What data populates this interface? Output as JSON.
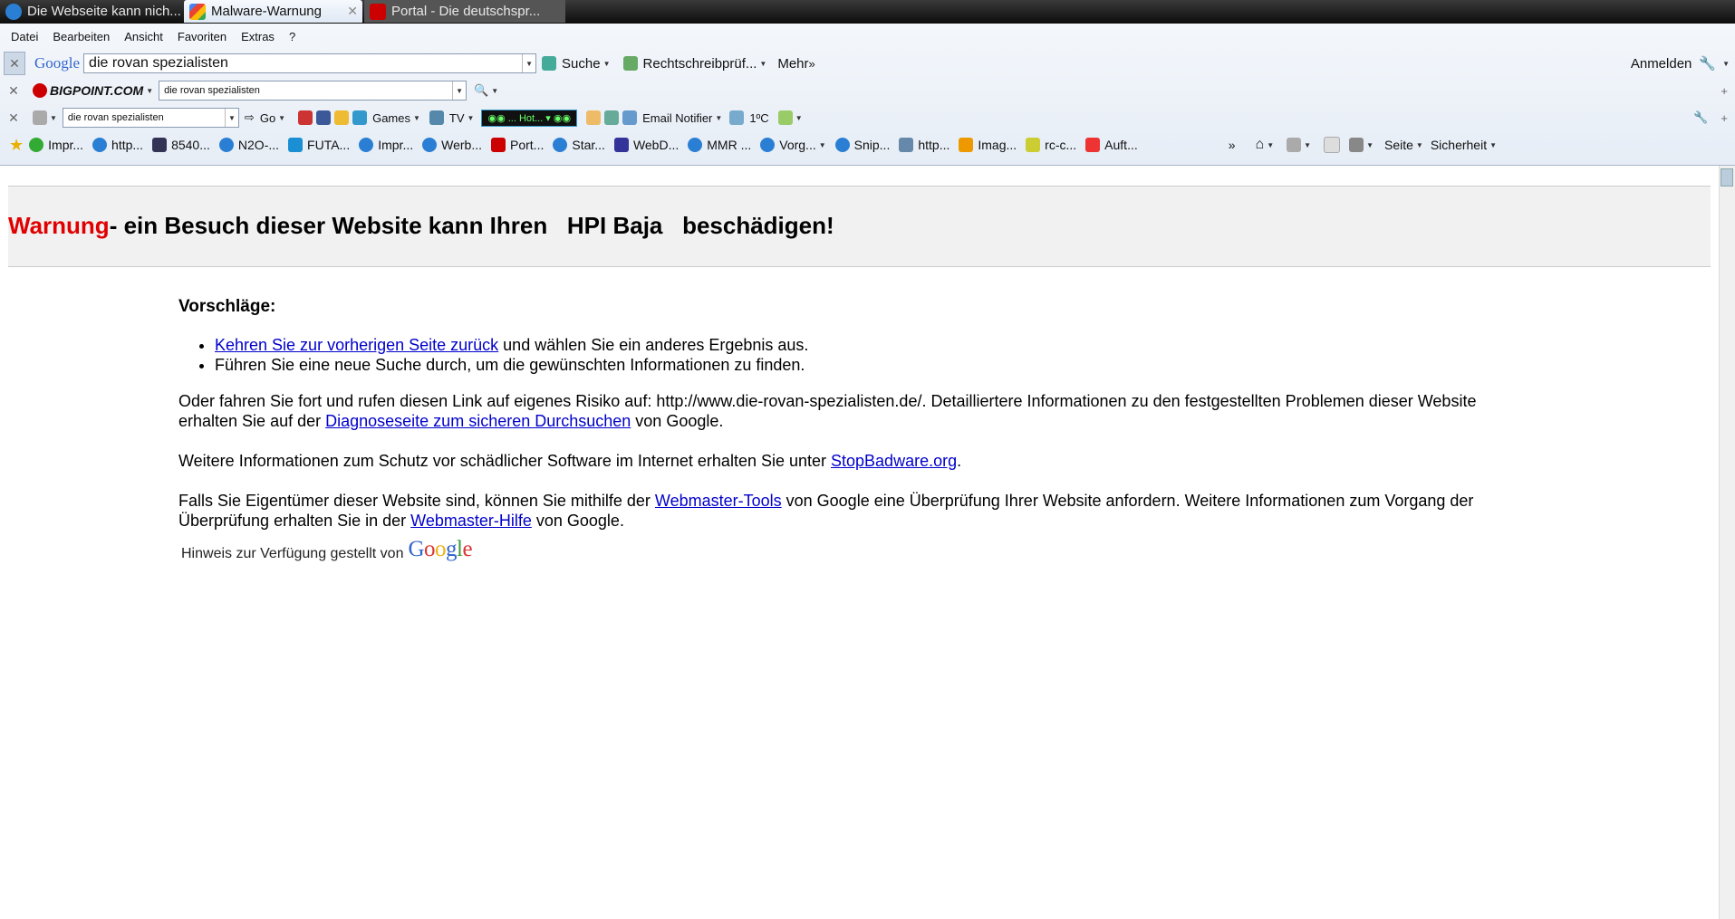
{
  "tabs": [
    {
      "label": "Die Webseite kann nich...",
      "active": false
    },
    {
      "label": "Malware-Warnung",
      "active": true
    },
    {
      "label": "Portal - Die deutschspr...",
      "active": false
    }
  ],
  "menu": [
    "Datei",
    "Bearbeiten",
    "Ansicht",
    "Favoriten",
    "Extras",
    "?"
  ],
  "google_toolbar": {
    "logo": "Google",
    "query": "die rovan spezialisten",
    "search": "Suche",
    "spell": "Rechtschreibprüf...",
    "more": "Mehr",
    "signin": "Anmelden"
  },
  "bigpoint_toolbar": {
    "logo": "BIGPOINT.COM",
    "query": "die rovan spezialisten"
  },
  "third_toolbar": {
    "query": "die rovan spezialisten",
    "go": "Go",
    "games": "Games",
    "tv": "TV",
    "hot": "... Hot...",
    "notifier": "Email Notifier",
    "temp": "1ºC"
  },
  "favorites": [
    "Impr...",
    "http...",
    "8540...",
    "N2O-...",
    "FUTA...",
    "Impr...",
    "Werb...",
    "Port...",
    "Star...",
    "WebD...",
    "MMR ...",
    "Vorg...",
    "Snip...",
    "http...",
    "Imag...",
    "rc-c...",
    "Auft..."
  ],
  "command_bar": {
    "page": "Seite",
    "security": "Sicherheit"
  },
  "warning": {
    "prefix": "Warnung",
    "text": "- ein Besuch dieser Website kann Ihren   HPI Baja   beschädigen!"
  },
  "content": {
    "heading": "Vorschläge:",
    "bullet1_link": "Kehren Sie zur vorherigen Seite zurück",
    "bullet1_rest": " und wählen Sie ein anderes Ergebnis aus.",
    "bullet2": "Führen Sie eine neue Suche durch, um die gewünschten Informationen zu finden.",
    "p1_a": "Oder fahren Sie fort und rufen diesen Link auf eigenes Risiko auf: http://www.die-rovan-spezialisten.de/. Detailliertere Informationen zu den festgestellten Problemen dieser Website erhalten Sie auf der ",
    "p1_link": "Diagnoseseite zum sicheren Durchsuchen",
    "p1_b": " von Google.",
    "p2_a": "Weitere Informationen zum Schutz vor schädlicher Software im Internet erhalten Sie unter ",
    "p2_link": "StopBadware.org",
    "p2_b": ".",
    "p3_a": "Falls Sie Eigentümer dieser Website sind, können Sie mithilfe der ",
    "p3_link1": "Webmaster-Tools",
    "p3_b": " von Google eine Überprüfung Ihrer Website anfordern. Weitere Informationen zum Vorgang der Überprüfung erhalten Sie in der ",
    "p3_link2": "Webmaster-Hilfe",
    "p3_c": " von Google.",
    "note": "Hinweis zur Verfügung gestellt von",
    "note_logo": "Google"
  }
}
